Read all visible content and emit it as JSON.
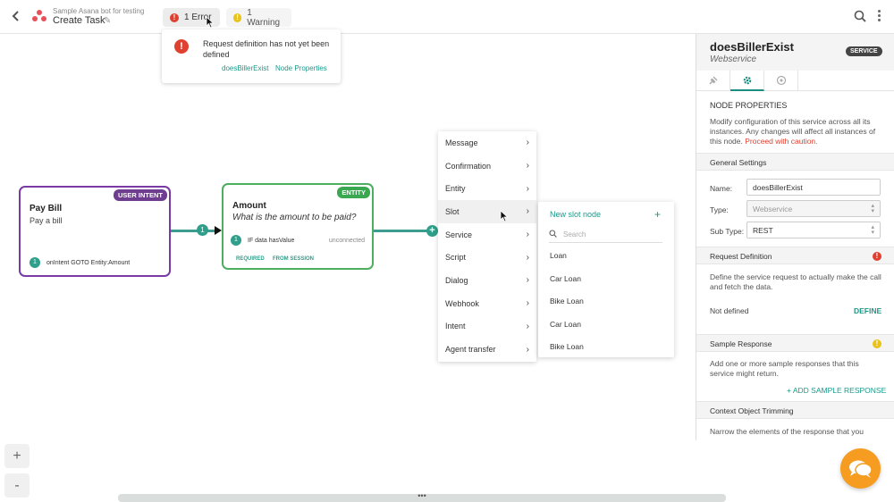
{
  "topbar": {
    "bot_subtitle": "Sample Asana bot for testing",
    "title": "Create Task",
    "error_tab": "1 Error",
    "warning_tab": "1 Warning"
  },
  "error_popover": {
    "message": "Request definition has not yet been defined",
    "link_service": "doesBillerExist",
    "link_props": "Node Properties"
  },
  "nodes": {
    "pay_bill": {
      "tag": "USER INTENT",
      "title": "Pay Bill",
      "subtitle": "Pay a bill",
      "route_num": "1",
      "route_text": "onIntent GOTO Entity:Amount"
    },
    "amount": {
      "tag": "ENTITY",
      "title": "Amount",
      "prompt": "What is the amount to be paid?",
      "cond_num": "1",
      "cond_text": "IF data hasValue",
      "cond_status": "unconnected",
      "flag_required": "REQUIRED",
      "flag_session": "FROM SESSION"
    },
    "connector_num": "1"
  },
  "context_menu": {
    "items": [
      "Message",
      "Confirmation",
      "Entity",
      "Slot",
      "Service",
      "Script",
      "Dialog",
      "Webhook",
      "Intent",
      "Agent transfer"
    ]
  },
  "slot_submenu": {
    "new_label": "New slot node",
    "search_placeholder": "Search",
    "options": [
      "Loan",
      "Car Loan",
      "Bike Loan",
      "Car Loan",
      "Bike Loan"
    ]
  },
  "panel": {
    "service_name": "doesBillerExist",
    "service_kind": "Webservice",
    "badge": "SERVICE",
    "section_title": "NODE PROPERTIES",
    "intro": "Modify configuration of this service across all its instances. Any changes will affect all instances of this node.",
    "caution": "Proceed with caution.",
    "general_settings": "General Settings",
    "name_label": "Name:",
    "name_value": "doesBillerExist",
    "type_label": "Type:",
    "type_value": "Webservice",
    "subtype_label": "Sub Type:",
    "subtype_value": "REST",
    "request_def": "Request Definition",
    "request_desc": "Define the service request to actually make the call and fetch the data.",
    "not_defined": "Not defined",
    "define": "DEFINE",
    "sample_response": "Sample Response",
    "sample_desc": "Add one or more sample responses that this service might return.",
    "add_sample": "+ ADD SAMPLE RESPONSE",
    "trimming": "Context Object Trimming",
    "trimming_desc": "Narrow the elements of the response that you"
  },
  "zoom": {
    "in": "+",
    "out": "-"
  },
  "colors": {
    "accent": "#1a9a8a",
    "error": "#e0402f",
    "warning": "#e8c31c",
    "intent_purple": "#7b3aa3",
    "entity_green": "#4cae5e",
    "chat_orange": "#f59c21"
  }
}
